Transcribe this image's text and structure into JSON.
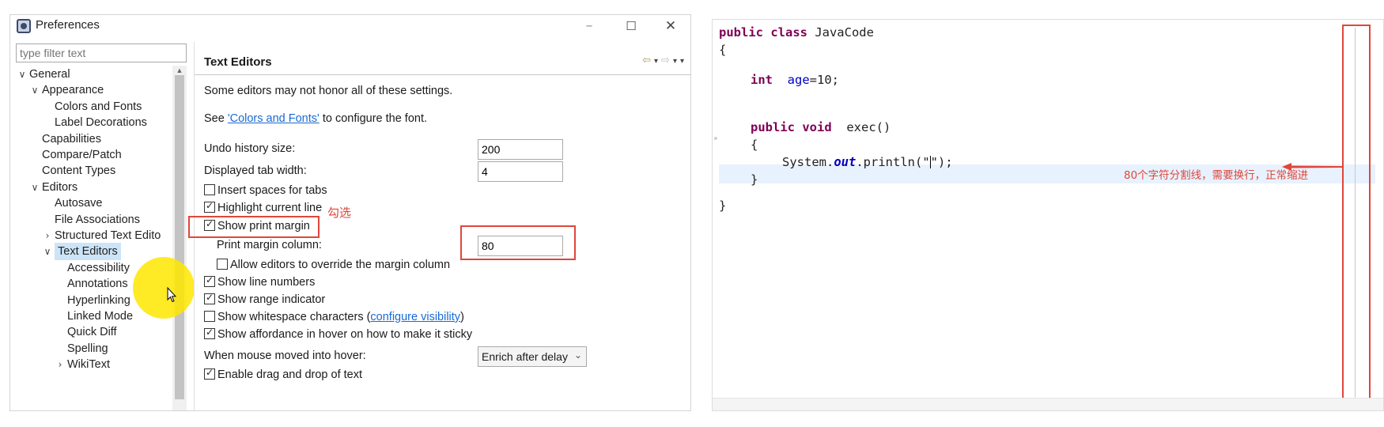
{
  "window": {
    "title": "Preferences",
    "min_glyph": "–",
    "max_glyph": "☐",
    "close_glyph": "✕"
  },
  "filter": {
    "placeholder": "type filter text"
  },
  "tree": [
    {
      "label": "General",
      "chevron": "∨"
    },
    {
      "label": "Appearance",
      "chevron": "∨"
    },
    {
      "label": "Colors and Fonts",
      "chevron": ""
    },
    {
      "label": "Label Decorations",
      "chevron": ""
    },
    {
      "label": "Capabilities",
      "chevron": ""
    },
    {
      "label": "Compare/Patch",
      "chevron": ""
    },
    {
      "label": "Content Types",
      "chevron": ""
    },
    {
      "label": "Editors",
      "chevron": "∨"
    },
    {
      "label": "Autosave",
      "chevron": ""
    },
    {
      "label": "File Associations",
      "chevron": ""
    },
    {
      "label": "Structured Text Edito",
      "chevron": "›"
    },
    {
      "label": "Text Editors",
      "chevron": "∨",
      "selected": true
    },
    {
      "label": "Accessibility",
      "chevron": ""
    },
    {
      "label": "Annotations",
      "chevron": ""
    },
    {
      "label": "Hyperlinking",
      "chevron": ""
    },
    {
      "label": "Linked Mode",
      "chevron": ""
    },
    {
      "label": "Quick Diff",
      "chevron": ""
    },
    {
      "label": "Spelling",
      "chevron": ""
    },
    {
      "label": "WikiText",
      "chevron": "›"
    }
  ],
  "page": {
    "title": "Text Editors",
    "nav": {
      "back": "⇦",
      "forward": "⇨",
      "menu": "▾"
    },
    "intro": "Some editors may not honor all of these settings.",
    "see_prefix": "See ",
    "see_link": "'Colors and Fonts'",
    "see_suffix": " to configure the font.",
    "undo_label": "Undo history size:",
    "undo_value": "200",
    "tab_label": "Displayed tab width:",
    "tab_value": "4",
    "insert_spaces": "Insert spaces for tabs",
    "highlight_line": "Highlight current line",
    "show_print_margin": "Show print margin",
    "print_margin_label": "Print margin column:",
    "print_margin_value": "80",
    "allow_override": "Allow editors to override the margin column",
    "show_line_numbers": "Show line numbers",
    "show_range": "Show range indicator",
    "show_whitespace_prefix": "Show whitespace characters (",
    "show_whitespace_link": "configure visibility",
    "show_whitespace_suffix": ")",
    "show_affordance": "Show affordance in hover on how to make it sticky",
    "hover_label": "When mouse moved into hover:",
    "hover_value": "Enrich after delay",
    "drag_drop": "Enable drag and drop of text"
  },
  "checkboxes": {
    "insert_spaces": false,
    "highlight_line": true,
    "show_print_margin": true,
    "allow_override": false,
    "show_line_numbers": true,
    "show_range": true,
    "show_whitespace": false,
    "show_affordance": true,
    "drag_drop": true
  },
  "annotations": {
    "check_note": "勾选",
    "margin_note": "80个字符分割线，需要换行，正常缩进",
    "color": "#e0463a"
  },
  "code": {
    "l1_kw": "public class",
    "l1_name": " JavaCode",
    "l2": "{",
    "l3_kw": "int",
    "l3_field": "age",
    "l3_rest": "=10;",
    "l4_kw": "public void",
    "l4_rest": "  exec()",
    "l5": "{",
    "l6_a": "System.",
    "l6_b": "out",
    "l6_c": ".println(\"",
    "l6_d": "\");",
    "l7": "}",
    "l8": "}"
  },
  "colors": {
    "keyword": "#7f0055",
    "field": "#0000c0",
    "selection": "#cce4f7",
    "current_line": "#e8f2fe",
    "link": "#1a6ad4",
    "highlight_circle": "#ffe600"
  }
}
